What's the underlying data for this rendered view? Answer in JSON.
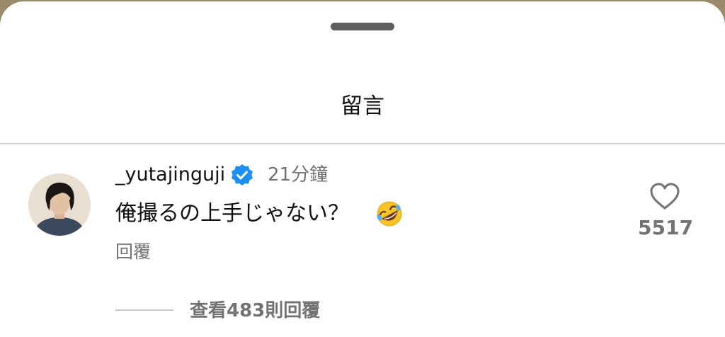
{
  "sheet": {
    "title": "留言"
  },
  "comment": {
    "username": "_yutajinguji",
    "verified": true,
    "time": "21分鐘",
    "text": "俺撮るの上手じゃない？",
    "emoji": "rolling-on-floor-laughing",
    "reply_label": "回覆",
    "like_count": "5517",
    "view_replies_label": "查看483則回覆"
  },
  "colors": {
    "background_strip": "#9a8a6a",
    "sheet": "#ffffff",
    "verified_badge": "#1d8ff2",
    "secondary_text": "#737373"
  }
}
